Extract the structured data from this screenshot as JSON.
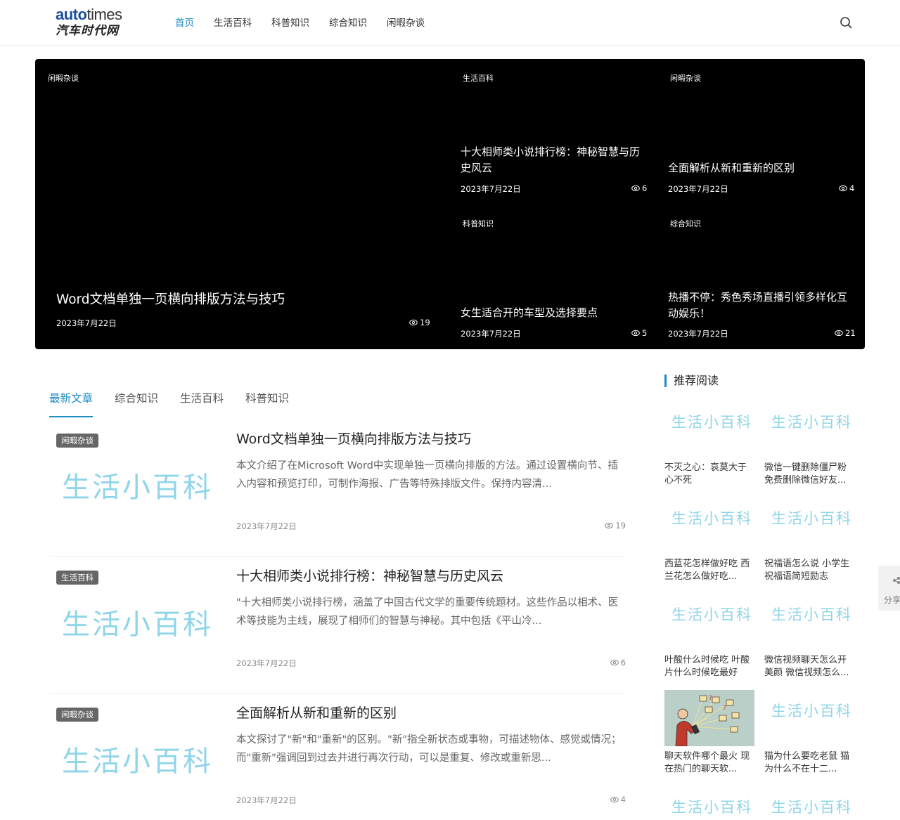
{
  "header": {
    "logo_top_a": "auto",
    "logo_top_b": "times",
    "logo_bottom": "汽车时代网",
    "nav": [
      "首页",
      "生活百科",
      "科普知识",
      "综合知识",
      "闲暇杂谈"
    ],
    "active_nav": "首页"
  },
  "hero": {
    "main": {
      "tag": "闲暇杂谈",
      "title": "Word文档单独一页横向排版方法与技巧",
      "date": "2023年7月22日",
      "views": "19"
    },
    "tr1": {
      "tag": "生活百科",
      "title": "十大相师类小说排行榜：神秘智慧与历史风云",
      "date": "2023年7月22日",
      "views": "6"
    },
    "tr2": {
      "tag": "闲暇杂谈",
      "title": "全面解析从新和重新的区别",
      "date": "2023年7月22日",
      "views": "4"
    },
    "br1": {
      "tag": "科普知识",
      "title": "女生适合开的车型及选择要点",
      "date": "2023年7月22日",
      "views": "5"
    },
    "br2": {
      "tag": "综合知识",
      "title": "热播不停：秀色秀场直播引领多样化互动娱乐！",
      "date": "2023年7月22日",
      "views": "21"
    }
  },
  "tabs": [
    "最新文章",
    "综合知识",
    "生活百科",
    "科普知识"
  ],
  "watermark": "生活小百科",
  "articles": [
    {
      "tag": "闲暇杂谈",
      "title": "Word文档单独一页横向排版方法与技巧",
      "excerpt": "本文介绍了在Microsoft Word中实现单独一页横向排版的方法。通过设置横向节、插入内容和预览打印，可制作海报、广告等特殊排版文件。保持内容清...",
      "date": "2023年7月22日",
      "views": "19"
    },
    {
      "tag": "生活百科",
      "title": "十大相师类小说排行榜：神秘智慧与历史风云",
      "excerpt": "\"十大相师类小说排行榜，涵盖了中国古代文学的重要传统题材。这些作品以相术、医术等技能为主线，展现了相师们的智慧与神秘。其中包括《平山冷...",
      "date": "2023年7月22日",
      "views": "6"
    },
    {
      "tag": "闲暇杂谈",
      "title": "全面解析从新和重新的区别",
      "excerpt": "本文探讨了\"新\"和\"重新\"的区别。\"新\"指全新状态或事物，可描述物体、感觉或情况；而\"重新\"强调回到过去并进行再次行动，可以是重复、修改或重新思...",
      "date": "2023年7月22日",
      "views": "4"
    }
  ],
  "sidebar": {
    "title": "推荐阅读",
    "items": [
      {
        "caption": "不灭之心：哀莫大于心不死"
      },
      {
        "caption": "微信一键删除僵尸粉 免费删除微信好友..."
      },
      {
        "caption": "西蓝花怎样做好吃 西兰花怎么做好吃..."
      },
      {
        "caption": "祝福语怎么说 小学生祝福语简短励志"
      },
      {
        "caption": "叶酸什么时候吃 叶酸片什么时候吃最好"
      },
      {
        "caption": "微信视频聊天怎么开美颜 微信视频怎么..."
      },
      {
        "caption": "聊天软件哪个最火 现在热门的聊天软..."
      },
      {
        "caption": "猫为什么要吃老鼠 猫为什么不在十二..."
      }
    ]
  },
  "share_label": "分享"
}
